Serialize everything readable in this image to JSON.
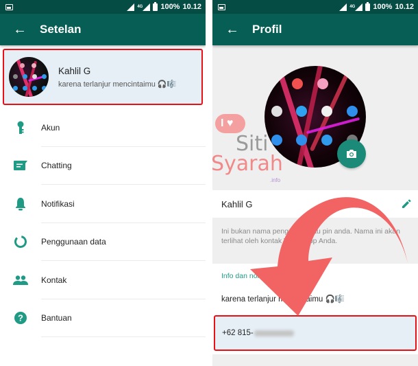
{
  "status_bar": {
    "battery": "100%",
    "time": "10.12",
    "network": "4G"
  },
  "left_screen": {
    "title": "Setelan",
    "profile": {
      "name": "Kahlil G",
      "about": "karena terlanjur mencintaimu 🎧🎼"
    },
    "menu": [
      {
        "label": "Akun",
        "icon": "key-icon"
      },
      {
        "label": "Chatting",
        "icon": "chat-icon"
      },
      {
        "label": "Notifikasi",
        "icon": "bell-icon"
      },
      {
        "label": "Penggunaan data",
        "icon": "data-usage-icon"
      },
      {
        "label": "Kontak",
        "icon": "contacts-icon"
      },
      {
        "label": "Bantuan",
        "icon": "help-icon"
      }
    ]
  },
  "right_screen": {
    "title": "Profil",
    "name": "Kahlil G",
    "name_hint": "Ini bukan nama pengguna atau pin anda. Nama ini akan terlihat oleh kontak WhatsApp Anda.",
    "info_section_label": "Info dan nomor telepon",
    "about": "karena terlanjur mencintaimu 🎧🎼",
    "phone_prefix": "+62 815-"
  },
  "watermark": {
    "bubble": "I ♥",
    "line1": "Siti",
    "line2": "Syarah",
    "line3": ".info"
  },
  "colors": {
    "accent": "#075e54",
    "status_bar": "#054d44",
    "icon_teal": "#1e9a85",
    "highlight_border": "#e81014",
    "arrow": "#f26363"
  }
}
